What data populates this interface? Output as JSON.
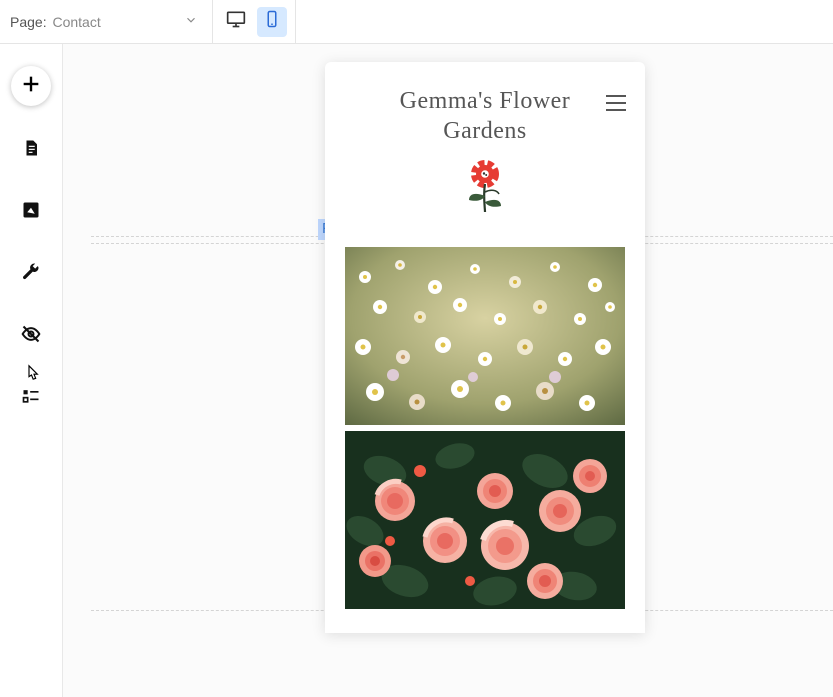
{
  "topbar": {
    "page_label": "Page:",
    "page_value": "Contact"
  },
  "canvas": {
    "section_tag": "Page"
  },
  "site": {
    "title": "Gemma's Flower Gardens"
  }
}
